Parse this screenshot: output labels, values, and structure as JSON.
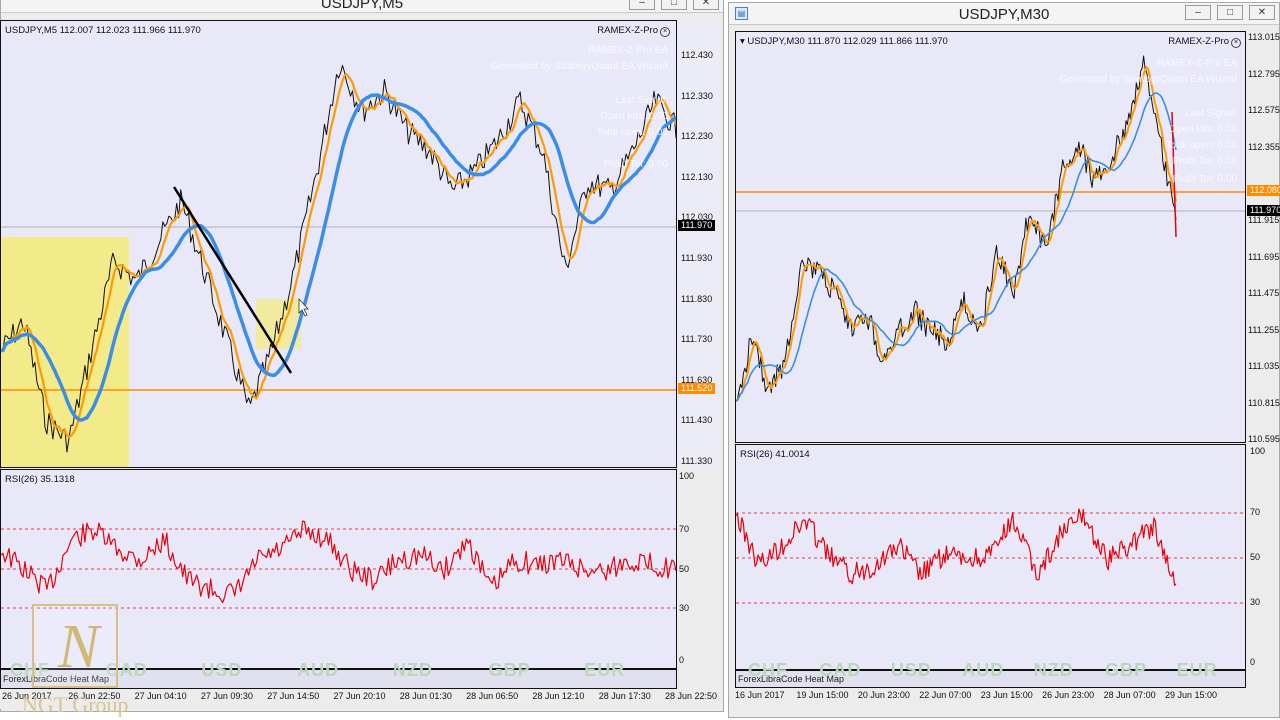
{
  "left": {
    "title": "USDJPY,M5",
    "main_label": "USDJPY,M5  112.007 112.023 111.966 111.970",
    "ea_label": "RAMEX-Z-Pro",
    "ghost_lines": [
      "RAMEX-Z-Pro EA",
      "Generated by StrategyQuant EA Wizard",
      "Last Signal:",
      "Open lots: 0.00",
      "Total open: 0.00",
      "Profit Tot: 0.00"
    ],
    "price_axis": [
      "112.430",
      "112.330",
      "112.230",
      "112.130",
      "112.030",
      "111.930",
      "111.830",
      "111.730",
      "111.630",
      "111.430",
      "111.330"
    ],
    "current_price": "111.970",
    "level_price": "111.520",
    "rsi_label": "RSI(26) 35.1318",
    "rsi_axis": [
      "100",
      "70",
      "50",
      "30",
      "0"
    ],
    "heatmap_label": "ForexLibraCode Heat Map",
    "heatmap_ccy": [
      "CHF",
      "CAD",
      "USD",
      "AUD",
      "NZD",
      "GBP",
      "EUR"
    ],
    "time_axis": [
      "26 Jun 2017",
      "26 Jun 22:50",
      "27 Jun 04:10",
      "27 Jun 09:30",
      "27 Jun 14:50",
      "27 Jun 20:10",
      "28 Jun 01:30",
      "28 Jun 06:50",
      "28 Jun 12:10",
      "28 Jun 17:30",
      "28 Jun 22:50"
    ]
  },
  "right": {
    "title": "USDJPY,M30",
    "main_label": "USDJPY,M30  111.870 112.029 111.866 111.970",
    "ea_label": "RAMEX-Z-Pro",
    "ghost_lines": [
      "RAMEX-Z-Pro EA",
      "Generated by StrategyQuant EA Wizard",
      "Last Signal:",
      "Open lots: 0.00",
      "Total open: 0.00",
      "Profit Tot: 0.00",
      "Profit Tot: 0.00"
    ],
    "price_axis": [
      "113.015",
      "112.795",
      "112.575",
      "112.355",
      "111.915",
      "111.695",
      "111.475",
      "111.255",
      "111.035",
      "110.815",
      "110.595"
    ],
    "current_price": "111.970",
    "level_price": "112.080",
    "rsi_label": "RSI(26) 41.0014",
    "rsi_axis": [
      "100",
      "70",
      "50",
      "30",
      "0"
    ],
    "heatmap_label": "ForexLibraCode Heat Map",
    "heatmap_ccy": [
      "CHF",
      "CAD",
      "USD",
      "AUD",
      "NZD",
      "GBP",
      "EUR"
    ],
    "time_axis": [
      "16 Jun 2017",
      "19 Jun 15:00",
      "20 Jun 23:00",
      "22 Jun 07:00",
      "23 Jun 15:00",
      "26 Jun 23:00",
      "28 Jun 07:00",
      "29 Jun 15:00"
    ]
  },
  "watermark": {
    "letter": "N",
    "text": "NGT Group"
  },
  "colors": {
    "price": "#111111",
    "fast_ma": "#ff9a00",
    "slow_ma": "#3a8ee6",
    "rsi": "#e8000b",
    "level": "#ff8c00",
    "highlight": "#f3ea8a",
    "trendline": "#000000"
  }
}
